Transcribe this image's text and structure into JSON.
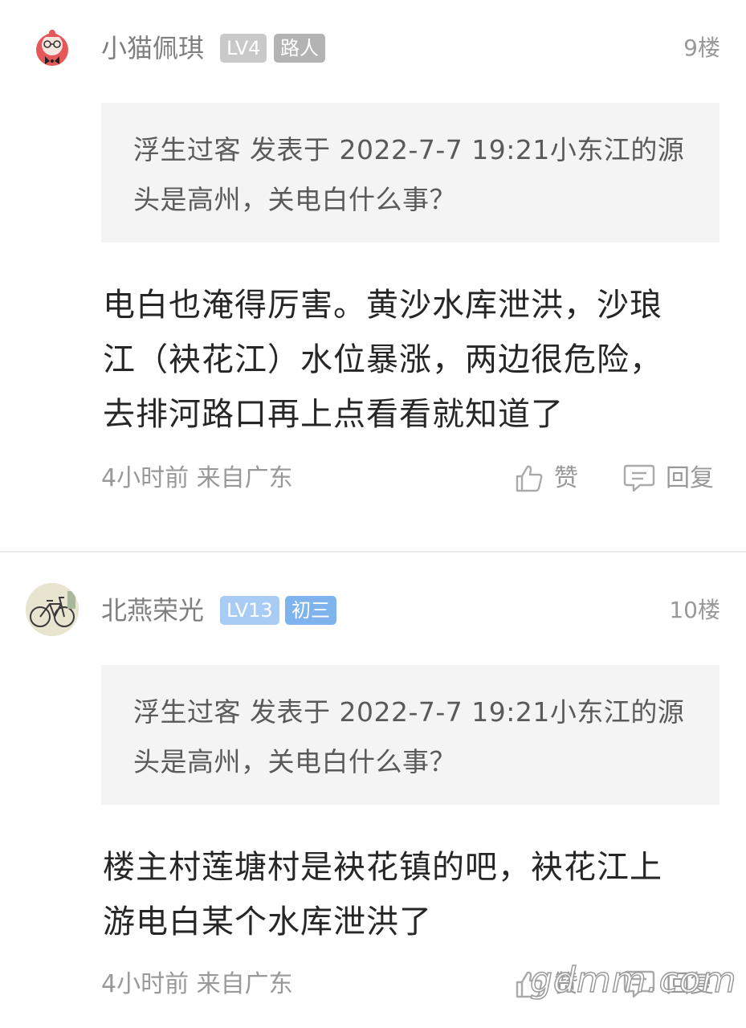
{
  "posts": [
    {
      "username": "小猫佩琪",
      "level": "LV4",
      "title": "路人",
      "level_color": "#c9c9c9",
      "title_color": "#b3b3b3",
      "floor": "9楼",
      "quote": "浮生过客 发表于 2022-7-7 19:21小东江的源头是高州，关电白什么事？",
      "content": "电白也淹得厉害。黄沙水库泄洪，沙琅江（袂花江）水位暴涨，两边很危险，去排河路口再上点看看就知道了",
      "time": "4小时前",
      "location": "来自广东",
      "like_label": "赞",
      "reply_label": "回复"
    },
    {
      "username": "北燕荣光",
      "level": "LV13",
      "title": "初三",
      "level_color": "#a9ccf5",
      "title_color": "#7fb3ee",
      "floor": "10楼",
      "quote": "浮生过客 发表于 2022-7-7 19:21小东江的源头是高州，关电白什么事？",
      "content": "楼主村莲塘村是袂花镇的吧，袂花江上游电白某个水库泄洪了",
      "time": "4小时前",
      "location": "来自广东",
      "like_label": "赞",
      "reply_label": "回复"
    }
  ],
  "watermark": "gdmm.com"
}
